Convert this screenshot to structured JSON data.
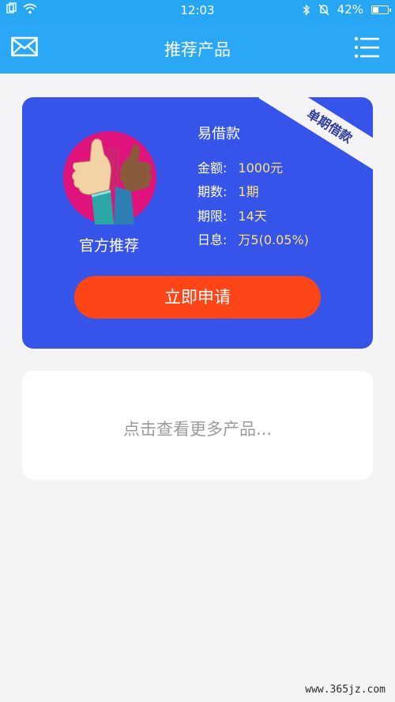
{
  "status_bar": {
    "time": "12:03",
    "battery": "42%",
    "battery_level": 0.42,
    "left_icons": [
      "copy-icon",
      "wifi-icon"
    ],
    "right_icons": [
      "bluetooth-icon",
      "bell-mute-icon"
    ]
  },
  "nav": {
    "title": "推荐产品",
    "left_icon": "mail-icon",
    "right_icon": "menu-icon"
  },
  "product": {
    "ribbon": "单期借款",
    "badge_label": "官方推荐",
    "name": "易借款",
    "rows": [
      {
        "label": "金额:",
        "value": "1000元"
      },
      {
        "label": "期数:",
        "value": "1期"
      },
      {
        "label": "期限:",
        "value": "14天"
      },
      {
        "label": "日息:",
        "value": "万5(0.05%)"
      }
    ],
    "apply_label": "立即申请"
  },
  "more": {
    "label": "点击查看更多产品..."
  },
  "watermark": "www.365jz.com",
  "colors": {
    "header": "#2aa8f5",
    "card": "#3653ea",
    "button": "#fe4517",
    "value_text": "#ffe27a"
  }
}
